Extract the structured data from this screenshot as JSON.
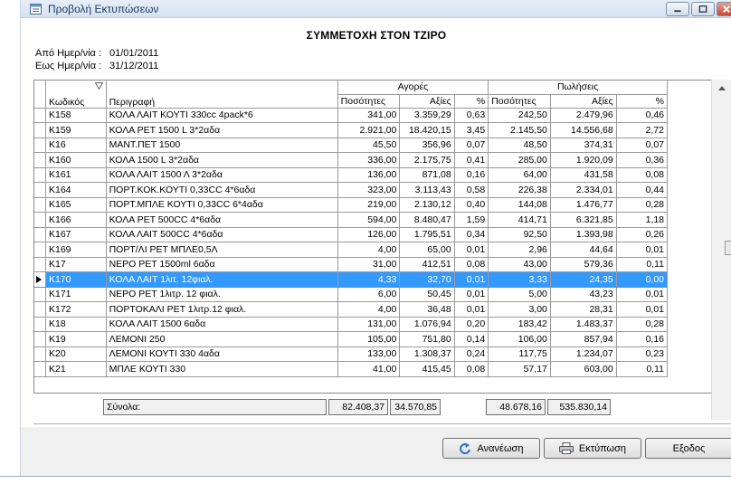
{
  "window": {
    "title": "Προβολή Εκτυπώσεων"
  },
  "report": {
    "title": "ΣΥΜΜΕΤΟΧΗ ΣΤΟΝ ΤΖΙΡΟ",
    "from_label": "Από Ημερ/νία :",
    "from_value": "01/01/2011",
    "to_label": "Εως Ημερ/νία :",
    "to_value": "31/12/2011"
  },
  "table": {
    "group_purchases": "Αγορές",
    "group_sales": "Πωλήσεις",
    "col_code": "Κωδικός",
    "col_desc": "Περιγραφή",
    "col_qty": "Ποσότητες",
    "col_value": "Αξίες",
    "col_pct": "%",
    "rows": [
      {
        "code": "K158",
        "desc": "ΚΟΛΑ ΛΑΙΤ ΚΟΥΤΙ 330cc 4pack*6",
        "p_qty": "341,00",
        "p_val": "3.359,29",
        "p_pct": "0,63",
        "s_qty": "242,50",
        "s_val": "2.479,96",
        "s_pct": "0,46"
      },
      {
        "code": "K159",
        "desc": "ΚΟΛΑ PET 1500 L 3*2αδα",
        "p_qty": "2.921,00",
        "p_val": "18.420,15",
        "p_pct": "3,45",
        "s_qty": "2.145,50",
        "s_val": "14.556,68",
        "s_pct": "2,72"
      },
      {
        "code": "K16",
        "desc": "ΜΑΝΤ.ΠΕΤ 1500",
        "p_qty": "45,50",
        "p_val": "356,96",
        "p_pct": "0,07",
        "s_qty": "48,50",
        "s_val": "374,31",
        "s_pct": "0,07"
      },
      {
        "code": "K160",
        "desc": "ΚΟΛΑ 1500 L 3*2αδα",
        "p_qty": "336,00",
        "p_val": "2.175,75",
        "p_pct": "0,41",
        "s_qty": "285,00",
        "s_val": "1.920,09",
        "s_pct": "0,36"
      },
      {
        "code": "K161",
        "desc": "ΚΟΛΑ ΛΑΙΤ 1500 Λ 3*2αδα",
        "p_qty": "136,00",
        "p_val": "871,08",
        "p_pct": "0,16",
        "s_qty": "64,00",
        "s_val": "431,58",
        "s_pct": "0,08"
      },
      {
        "code": "K164",
        "desc": "ΠΟΡΤ.ΚΟΚ.ΚΟΥΤΙ 0,33CC 4*6αδα",
        "p_qty": "323,00",
        "p_val": "3.113,43",
        "p_pct": "0,58",
        "s_qty": "226,38",
        "s_val": "2.334,01",
        "s_pct": "0,44"
      },
      {
        "code": "K165",
        "desc": "ΠΟΡΤ.ΜΠΛΕ ΚΟΥΤΙ 0,33CC 6*4αδα",
        "p_qty": "219,00",
        "p_val": "2.130,12",
        "p_pct": "0,40",
        "s_qty": "144,08",
        "s_val": "1.476,77",
        "s_pct": "0,28"
      },
      {
        "code": "K166",
        "desc": "ΚΟΛΑ PET 500CC 4*6αδα",
        "p_qty": "594,00",
        "p_val": "8.480,47",
        "p_pct": "1,59",
        "s_qty": "414,71",
        "s_val": "6.321,85",
        "s_pct": "1,18"
      },
      {
        "code": "K167",
        "desc": "ΚΟΛΑ ΛΑΙΤ 500CC 4*6αδα",
        "p_qty": "126,00",
        "p_val": "1.795,51",
        "p_pct": "0,34",
        "s_qty": "92,50",
        "s_val": "1.393,98",
        "s_pct": "0,26"
      },
      {
        "code": "K169",
        "desc": "ΠΟΡΤ/ΛΙ PET ΜΠΛΕ0,5Λ",
        "p_qty": "4,00",
        "p_val": "65,00",
        "p_pct": "0,01",
        "s_qty": "2,96",
        "s_val": "44,64",
        "s_pct": "0,01"
      },
      {
        "code": "K17",
        "desc": "ΝΕΡΟ PET 1500ml 6αδα",
        "p_qty": "31,00",
        "p_val": "412,51",
        "p_pct": "0,08",
        "s_qty": "43,00",
        "s_val": "579,36",
        "s_pct": "0,11"
      },
      {
        "code": "K170",
        "desc": "ΚΟΛΑ ΛΑΙΤ   1λιτ. 12φιαλ.",
        "p_qty": "4,33",
        "p_val": "32,70",
        "p_pct": "0,01",
        "s_qty": "3,33",
        "s_val": "24,35",
        "s_pct": "0,00",
        "selected": true
      },
      {
        "code": "K171",
        "desc": "ΝΕΡΟ PET 1λιτρ. 12 φιαλ.",
        "p_qty": "6,00",
        "p_val": "50,45",
        "p_pct": "0,01",
        "s_qty": "5,00",
        "s_val": "43,23",
        "s_pct": "0,01"
      },
      {
        "code": "K172",
        "desc": "ΠΟΡΤΟΚΑΛΙ PET 1λιτρ.12 φιαλ.",
        "p_qty": "4,00",
        "p_val": "36,48",
        "p_pct": "0,01",
        "s_qty": "3,00",
        "s_val": "28,31",
        "s_pct": "0,01"
      },
      {
        "code": "K18",
        "desc": "ΚΟΛΑ ΛΑΙΤ 1500 6αδα",
        "p_qty": "131,00",
        "p_val": "1.076,94",
        "p_pct": "0,20",
        "s_qty": "183,42",
        "s_val": "1.483,37",
        "s_pct": "0,28"
      },
      {
        "code": "K19",
        "desc": "ΛΕΜΟΝΙ 250",
        "p_qty": "105,00",
        "p_val": "751,80",
        "p_pct": "0,14",
        "s_qty": "106,00",
        "s_val": "857,94",
        "s_pct": "0,16"
      },
      {
        "code": "K20",
        "desc": "ΛΕΜΟΝΙ ΚΟΥΤΙ 330 4αδα",
        "p_qty": "133,00",
        "p_val": "1.308,37",
        "p_pct": "0,24",
        "s_qty": "117,75",
        "s_val": "1.234,07",
        "s_pct": "0,23"
      },
      {
        "code": "K21",
        "desc": "ΜΠΛΕ ΚΟΥΤΙ 330",
        "p_qty": "41,00",
        "p_val": "415,45",
        "p_pct": "0,08",
        "s_qty": "57,17",
        "s_val": "603,00",
        "s_pct": "0,11"
      }
    ]
  },
  "totals": {
    "label": "Σύνολα:",
    "p_qty": "82.408,37",
    "p_val": "34.570,85",
    "s_qty": "48.678,16",
    "s_val": "535.830,14"
  },
  "buttons": {
    "refresh": "Ανανέωση",
    "print": "Εκτύπωση",
    "exit": "Εξοδος"
  },
  "colors": {
    "selection": "#3399ff",
    "refresh_icon": "#2c6fd1"
  }
}
